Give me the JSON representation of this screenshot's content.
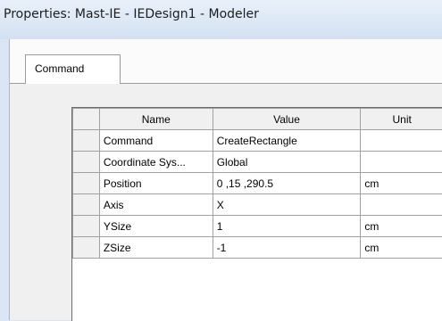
{
  "window": {
    "title": "Properties: Mast-IE - IEDesign1 - Modeler"
  },
  "tabs": [
    {
      "label": "Command"
    }
  ],
  "table": {
    "headers": {
      "name": "Name",
      "value": "Value",
      "unit": "Unit"
    },
    "rows": [
      {
        "name": "Command",
        "value": "CreateRectangle",
        "unit": ""
      },
      {
        "name": "Coordinate Sys...",
        "value": "Global",
        "unit": ""
      },
      {
        "name": "Position",
        "value": "0 ,15 ,290.5",
        "unit": "cm"
      },
      {
        "name": "Axis",
        "value": "X",
        "unit": ""
      },
      {
        "name": "YSize",
        "value": "1",
        "unit": "cm"
      },
      {
        "name": "ZSize",
        "value": "-1",
        "unit": "cm"
      }
    ]
  }
}
